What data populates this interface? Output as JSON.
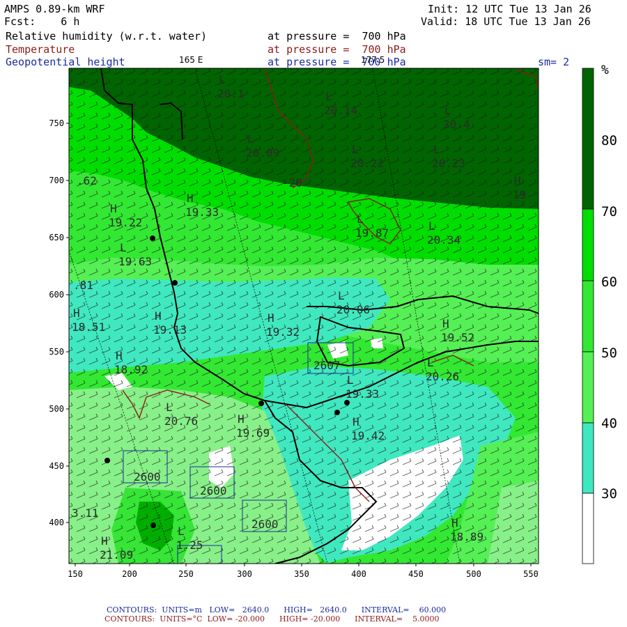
{
  "header": {
    "model": "AMPS 0.89-km WRF",
    "forecast": "Fcst:    6 h",
    "init": "Init: 12 UTC Tue 13 Jan 26",
    "valid": "Valid: 18 UTC Tue 13 Jan 26",
    "fields": [
      {
        "name": "Relative humidity (w.r.t. water)",
        "level": "at pressure =  700 hPa"
      },
      {
        "name": "Temperature",
        "level": "at pressure =  700 hPa"
      },
      {
        "name": "Geopotential height",
        "level": "at pressure =  700 hPa"
      }
    ],
    "lon_label_1": "165 E",
    "lon_label_2": "177.5",
    "smoothing": "sm= 2"
  },
  "axes": {
    "x_ticks": [
      "150",
      "200",
      "250",
      "300",
      "350",
      "400",
      "450",
      "500",
      "550"
    ],
    "y_ticks": [
      "400",
      "450",
      "500",
      "550",
      "600",
      "650",
      "700",
      "750"
    ]
  },
  "legend": {
    "unit": "%",
    "bands": [
      {
        "label": "80",
        "color": "#006400"
      },
      {
        "label": "70",
        "color": "#00dd00"
      },
      {
        "label": "60",
        "color": "#33e833"
      },
      {
        "label": "50",
        "color": "#55f055"
      },
      {
        "label": "40",
        "color": "#40e8c0"
      },
      {
        "label": "30",
        "color": "#ffffff"
      }
    ],
    "labels": [
      "80",
      "70",
      "60",
      "50",
      "40",
      "30"
    ]
  },
  "colors": {
    "rh_above_80": "#006400",
    "rh_70_80": "#00dd00",
    "rh_60_70": "#33e833",
    "rh_50_60": "#55f055",
    "rh_40_50": "#88f088",
    "rh_30_40": "#40e8c0",
    "rh_below_30": "#ffffff",
    "temperature_contour": "#8b1a1a",
    "height_contour": "#1a2aa0"
  },
  "map_labels": {
    "highs": [
      {
        "letter": "H",
        "value": "19.22"
      },
      {
        "letter": "H",
        "value": "19.33"
      },
      {
        "letter": "H",
        "value": "18.51"
      },
      {
        "letter": "H",
        "value": "19.13"
      },
      {
        "letter": "H",
        "value": "19.32"
      },
      {
        "letter": "H",
        "value": "18.92"
      },
      {
        "letter": "H",
        "value": "19.69"
      },
      {
        "letter": "H",
        "value": "19.42"
      },
      {
        "letter": "H",
        "value": "19.52"
      },
      {
        "letter": "H",
        "value": "18.89"
      },
      {
        "letter": "H",
        "value": "19"
      },
      {
        "letter": "H",
        "value": "21.09"
      }
    ],
    "lows": [
      {
        "letter": "L",
        "value": "20.1"
      },
      {
        "letter": "L",
        "value": "20.14"
      },
      {
        "letter": "L",
        "value": "20.4"
      },
      {
        "letter": "L",
        "value": "20.09"
      },
      {
        "letter": "L",
        "value": "20.22"
      },
      {
        "letter": "L",
        "value": "20.23"
      },
      {
        "letter": "L",
        "value": "19.63"
      },
      {
        "letter": "L",
        "value": "19.87"
      },
      {
        "letter": "L",
        "value": "20.34"
      },
      {
        "letter": "L",
        "value": "20.06"
      },
      {
        "letter": "L",
        "value": "20.26"
      },
      {
        "letter": "L",
        "value": "20.76"
      },
      {
        "letter": "L",
        "value": "19.33"
      },
      {
        "letter": "L",
        "value": "1.25"
      }
    ],
    "loose": [
      "-20",
      ".62",
      ".81",
      "3.11"
    ],
    "height_lows": [
      "2607",
      "2600",
      "2600",
      "2600"
    ]
  },
  "footer": {
    "line1": "CONTOURS:  UNITS=m   LOW=   2640.0      HIGH=   2640.0      INTERVAL=    60.000",
    "line2": "CONTOURS:  UNITS=°C  LOW= -20.000      HIGH= -20.000      INTERVAL=    5.0000"
  }
}
